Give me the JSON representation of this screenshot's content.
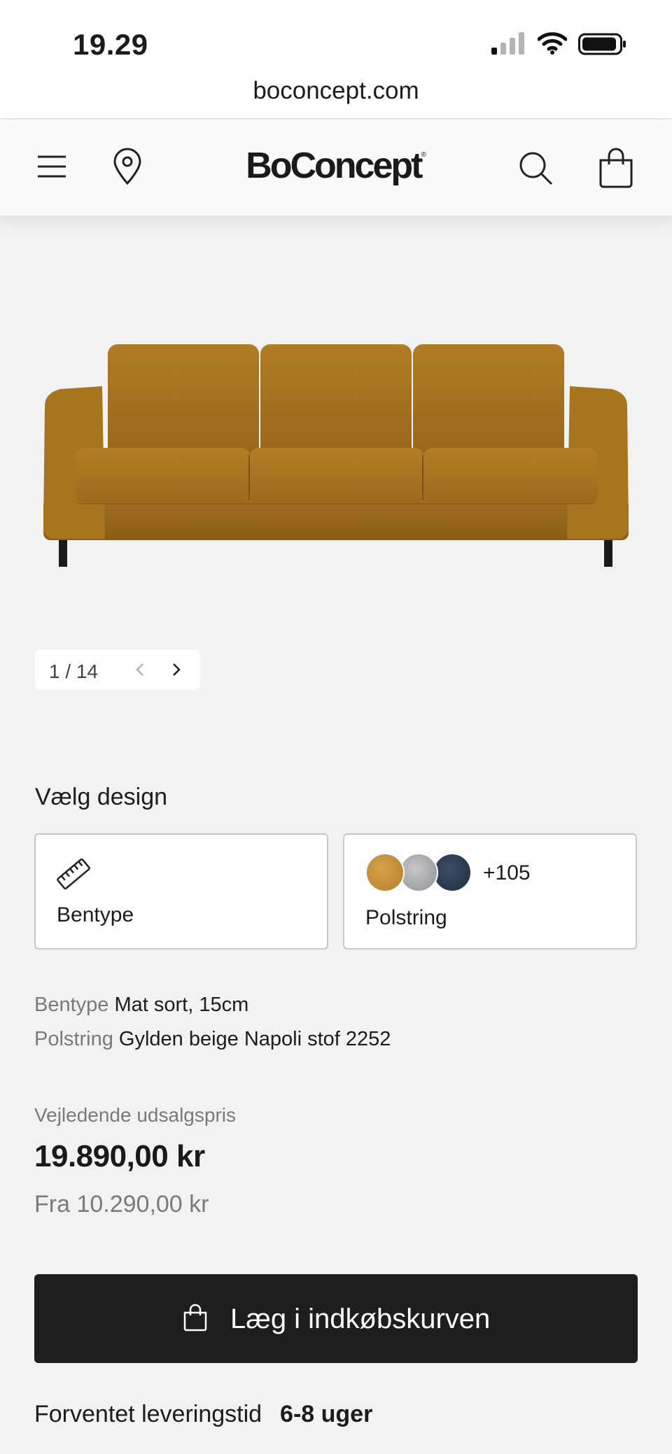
{
  "status_bar": {
    "time": "19.29"
  },
  "browser": {
    "url": "boconcept.com"
  },
  "header": {
    "logo": "BoConcept",
    "logo_mark": "®",
    "icons": [
      "menu-icon",
      "location-pin-icon",
      "search-icon",
      "shopping-bag-icon"
    ]
  },
  "gallery": {
    "counter": "1 / 14",
    "current": 1,
    "total": 14
  },
  "design": {
    "title": "Vælg design",
    "options": [
      {
        "label": "Bentype",
        "icon": "ruler-icon"
      },
      {
        "label": "Polstring",
        "more_count": "+105",
        "swatch_colors": [
          "#c58f3c",
          "#a9aaac",
          "#2b3a50"
        ]
      }
    ]
  },
  "selection": [
    {
      "key": "Bentype",
      "value": "Mat sort, 15cm"
    },
    {
      "key": "Polstring",
      "value": "Gylden beige Napoli stof 2252"
    }
  ],
  "price": {
    "label": "Vejledende udsalgspris",
    "amount": "19.890,00 kr",
    "from": "Fra 10.290,00 kr"
  },
  "cart_button": {
    "label": "Læg i indkøbskurven"
  },
  "delivery": {
    "label": "Forventet leveringstid",
    "value": "6-8 uger"
  },
  "colors": {
    "sofa": "#a8741f",
    "button_bg": "#1e1e1e",
    "page_bg": "#f2f2f2"
  }
}
